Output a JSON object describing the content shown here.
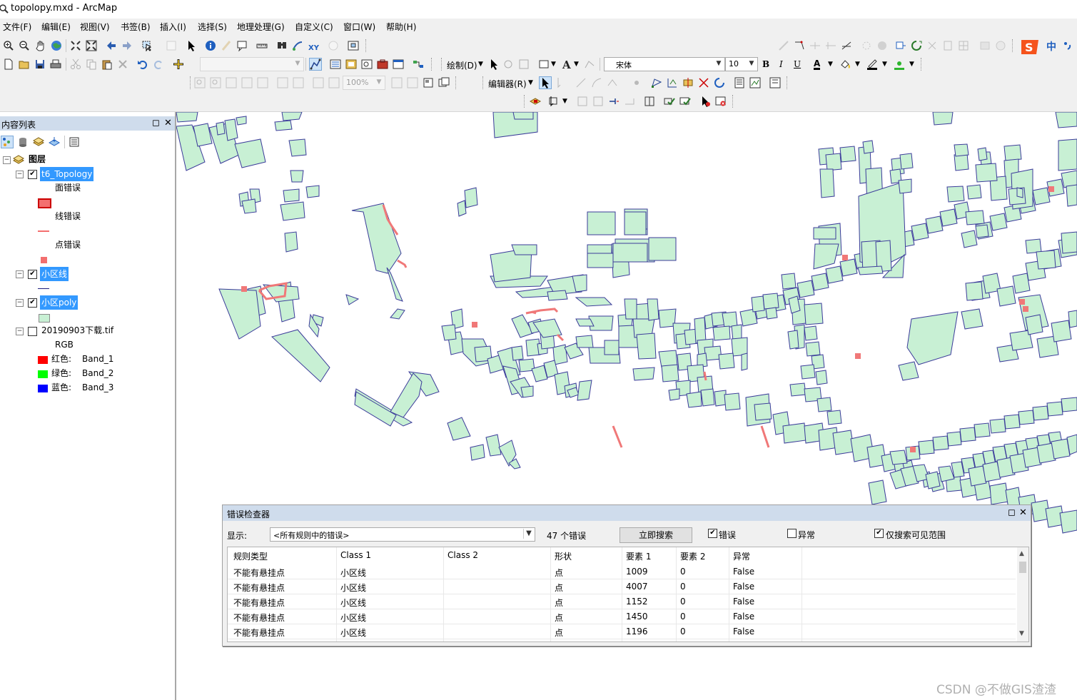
{
  "window": {
    "title": "topolopy.mxd - ArcMap"
  },
  "menu": [
    "文件(F)",
    "编辑(E)",
    "视图(V)",
    "书签(B)",
    "插入(I)",
    "选择(S)",
    "地理处理(G)",
    "自定义(C)",
    "窗口(W)",
    "帮助(H)"
  ],
  "toolbar": {
    "draw_label": "绘制(D)",
    "font_name": "宋体",
    "font_size": "10",
    "bold": "B",
    "italic": "I",
    "underline": "U",
    "font_color": "A",
    "zoom_percent": "100%",
    "editor_label": "编辑器(R)",
    "ime_label": "中"
  },
  "toc": {
    "title": "内容列表",
    "layers_root": "图层",
    "layers": [
      {
        "name": "t6_Topology",
        "items": [
          "面错误",
          "线错误",
          "点错误"
        ]
      },
      {
        "name": "小区线"
      },
      {
        "name": "小区poly"
      },
      {
        "name": "20190903下载.tif",
        "sublabel": "RGB",
        "bands": [
          {
            "label": "红色:",
            "band": "Band_1"
          },
          {
            "label": "绿色:",
            "band": "Band_2"
          },
          {
            "label": "蓝色:",
            "band": "Band_3"
          }
        ]
      }
    ]
  },
  "error_inspector": {
    "title": "错误检查器",
    "show_label": "显示:",
    "show_value": "<所有规则中的错误>",
    "count_text": "47 个错误",
    "search_button": "立即搜索",
    "chk_errors": "错误",
    "chk_exceptions": "异常",
    "chk_visible": "仅搜索可见范围",
    "columns": [
      "规则类型",
      "Class 1",
      "Class 2",
      "形状",
      "要素 1",
      "要素 2",
      "异常"
    ],
    "rows": [
      [
        "不能有悬挂点",
        "小区线",
        "",
        "点",
        "1009",
        "0",
        "False"
      ],
      [
        "不能有悬挂点",
        "小区线",
        "",
        "点",
        "4007",
        "0",
        "False"
      ],
      [
        "不能有悬挂点",
        "小区线",
        "",
        "点",
        "1152",
        "0",
        "False"
      ],
      [
        "不能有悬挂点",
        "小区线",
        "",
        "点",
        "1450",
        "0",
        "False"
      ],
      [
        "不能有悬挂点",
        "小区线",
        "",
        "点",
        "1196",
        "0",
        "False"
      ]
    ]
  },
  "watermark": "CSDN @不做GIS渣渣",
  "colors": {
    "polygon_fill": "#c8f0d4",
    "polygon_stroke": "#3b3b9a",
    "error": "#f07878",
    "selection": "#3399ff",
    "panel_head": "#cfdcec"
  }
}
